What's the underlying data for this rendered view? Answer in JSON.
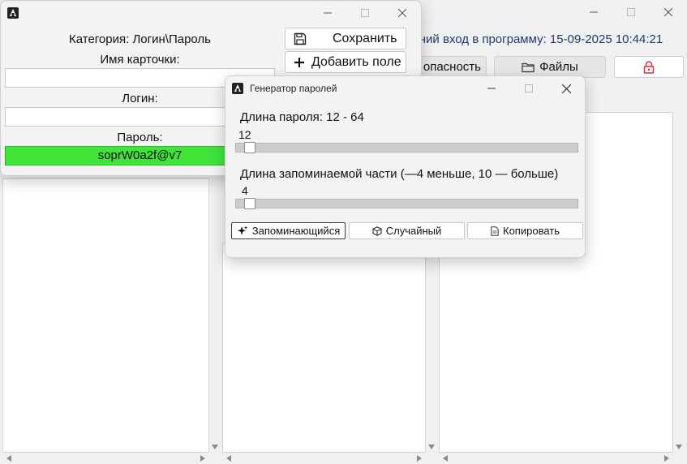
{
  "main_window": {
    "last_login": "едний вход в программу: 15-09-2025 10:44:21",
    "tabs": [
      {
        "label": "опасность",
        "icon": ""
      },
      {
        "label": "Файлы",
        "icon": "folder-icon"
      },
      {
        "label": "",
        "icon": "lock-icon"
      }
    ]
  },
  "card_window": {
    "category": "Категория: Логин\\Пароль",
    "name_label": "Имя карточки:",
    "name_value": "",
    "login_label": "Логин:",
    "login_value": "",
    "password_label": "Пароль:",
    "password_value": "soprW0a2f@v7",
    "buttons": {
      "save": "Сохранить",
      "add_field": "Добавить поле"
    }
  },
  "generator_window": {
    "title": "Генератор паролей",
    "length_label": "Длина пароля: 12 - 64",
    "length_value": "12",
    "length_fraction": 0.0,
    "memorable_label": "Длина запоминаемой части (—4 меньше, 10 — больше)",
    "memorable_value": "4",
    "memorable_fraction": 0.0,
    "buttons": {
      "memorable": "Запоминающийся",
      "random": "Случайный",
      "copy": "Копировать"
    }
  },
  "colors": {
    "password_ok": "#3fe33a",
    "lock_red": "#d9323a",
    "accent_text": "#1f3b6e"
  }
}
